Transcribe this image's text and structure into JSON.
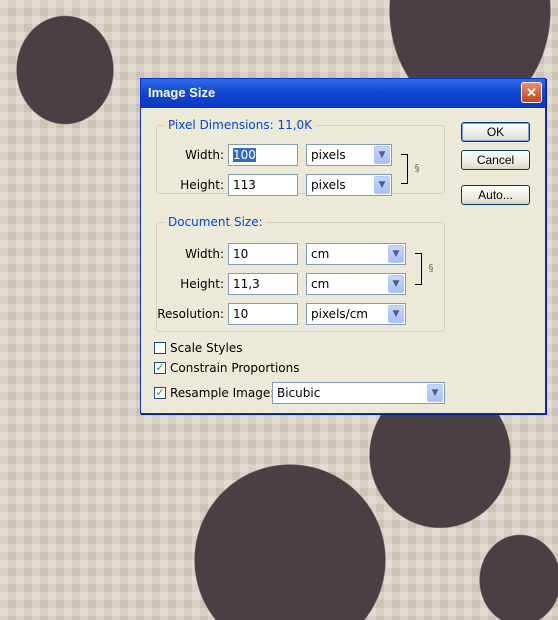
{
  "dialog": {
    "title": "Image Size",
    "close_glyph": "✕"
  },
  "pixel_dimensions": {
    "legend": "Pixel Dimensions:  11,0K",
    "width_label": "Width:",
    "width_value": "100",
    "width_unit": "pixels",
    "height_label": "Height:",
    "height_value": "113",
    "height_unit": "pixels"
  },
  "document_size": {
    "legend": "Document Size:",
    "width_label": "Width:",
    "width_value": "10",
    "width_unit": "cm",
    "height_label": "Height:",
    "height_value": "11,3",
    "height_unit": "cm",
    "resolution_label": "Resolution:",
    "resolution_value": "10",
    "resolution_unit": "pixels/cm"
  },
  "options": {
    "scale_styles_label": "Scale Styles",
    "scale_styles_checked": false,
    "constrain_label": "Constrain Proportions",
    "constrain_checked": true,
    "resample_label": "Resample Image:",
    "resample_checked": true,
    "resample_method": "Bicubic"
  },
  "buttons": {
    "ok": "OK",
    "cancel": "Cancel",
    "auto": "Auto..."
  },
  "icons": {
    "dropdown": "chevron-down-icon",
    "chain": "chain-link-icon",
    "check": "✓",
    "arrow": "▼",
    "link": "§"
  }
}
